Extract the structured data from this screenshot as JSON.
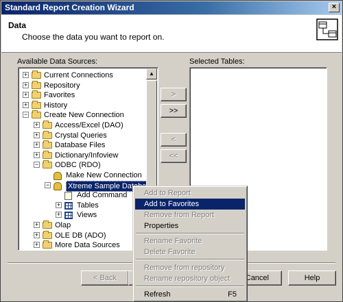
{
  "window": {
    "title": "Standard Report Creation Wizard",
    "close_glyph": "×"
  },
  "header": {
    "title": "Data",
    "subtitle": "Choose the data you want to report on.",
    "icon": "data-tables-icon"
  },
  "available": {
    "label": "Available Data Sources:",
    "tree": [
      {
        "label": "Current Connections",
        "icon": "folder-icon",
        "expander": "+"
      },
      {
        "label": "Repository",
        "icon": "folder-icon",
        "expander": "+"
      },
      {
        "label": "Favorites",
        "icon": "folder-icon",
        "expander": "+"
      },
      {
        "label": "History",
        "icon": "folder-icon",
        "expander": "+"
      },
      {
        "label": "Create New Connection",
        "icon": "folder-icon",
        "expander": "−"
      },
      {
        "label": "Access/Excel (DAO)",
        "icon": "folder-icon",
        "expander": "+"
      },
      {
        "label": "Crystal Queries",
        "icon": "folder-icon",
        "expander": "+"
      },
      {
        "label": "Database Files",
        "icon": "folder-icon",
        "expander": "+"
      },
      {
        "label": "Dictionary/Infoview",
        "icon": "folder-icon",
        "expander": "+"
      },
      {
        "label": "ODBC (RDO)",
        "icon": "folder-icon",
        "expander": "−"
      },
      {
        "label": "Make New Connection",
        "icon": "database-icon",
        "expander": ""
      },
      {
        "label": "Xtreme Sample Database",
        "icon": "database-icon",
        "expander": "−",
        "selected": true
      },
      {
        "label": "Add Command",
        "icon": "command-icon",
        "expander": ""
      },
      {
        "label": "Tables",
        "icon": "table-icon",
        "expander": "+"
      },
      {
        "label": "Views",
        "icon": "table-icon",
        "expander": "+"
      },
      {
        "label": "Olap",
        "icon": "folder-icon",
        "expander": "+"
      },
      {
        "label": "OLE DB (ADO)",
        "icon": "folder-icon",
        "expander": "+"
      },
      {
        "label": "More Data Sources",
        "icon": "folder-icon",
        "expander": "+"
      }
    ]
  },
  "selected": {
    "label": "Selected Tables:"
  },
  "transfer": {
    "add": ">",
    "add_all": ">>",
    "remove": "<",
    "remove_all": "<<"
  },
  "footer": {
    "back": "< Back",
    "cancel": "Cancel",
    "help": "Help"
  },
  "context_menu": {
    "items": [
      {
        "label": "Add to Report",
        "enabled": false
      },
      {
        "label": "Add to Favorites",
        "enabled": true,
        "highlighted": true
      },
      {
        "label": "Remove from Report",
        "enabled": false
      },
      {
        "label": "Properties",
        "enabled": true
      },
      {
        "label": "Rename Favorite",
        "enabled": false
      },
      {
        "label": "Delete Favorite",
        "enabled": false
      },
      {
        "label": "Remove from repository",
        "enabled": false
      },
      {
        "label": "Rename repository object",
        "enabled": false
      },
      {
        "label": "Refresh",
        "enabled": true,
        "shortcut": "F5"
      }
    ]
  }
}
